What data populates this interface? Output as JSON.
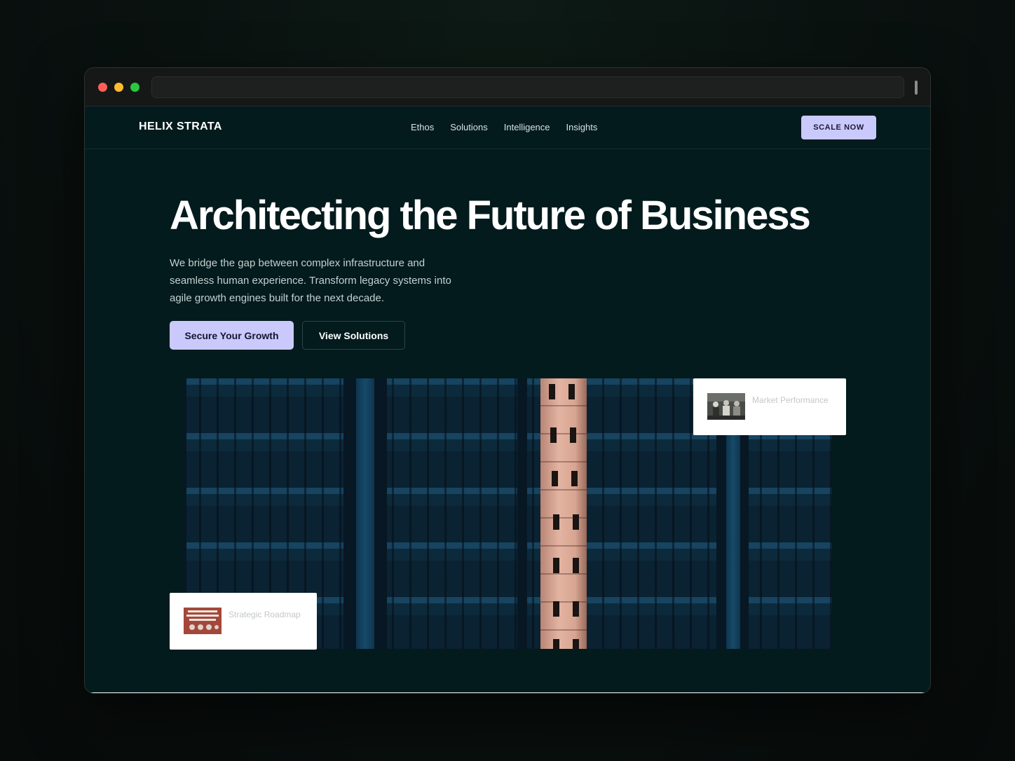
{
  "browser": {
    "url": ""
  },
  "nav": {
    "logo": "HELIX STRATA",
    "links": [
      "Ethos",
      "Solutions",
      "Intelligence",
      "Insights"
    ],
    "cta": "SCALE NOW"
  },
  "hero": {
    "title": "Architecting the Future of Business",
    "description": "We bridge the gap between complex infrastructure and seamless human experience. Transform legacy systems into agile growth engines built for the next decade.",
    "primary_button": "Secure Your Growth",
    "secondary_button": "View Solutions"
  },
  "cards": {
    "market": {
      "label": "Market Performance"
    },
    "roadmap": {
      "label": "Strategic Roadmap"
    }
  },
  "colors": {
    "accent": "#cac9fb",
    "page_bg": "#031b1d",
    "heading": "#ffffff"
  }
}
